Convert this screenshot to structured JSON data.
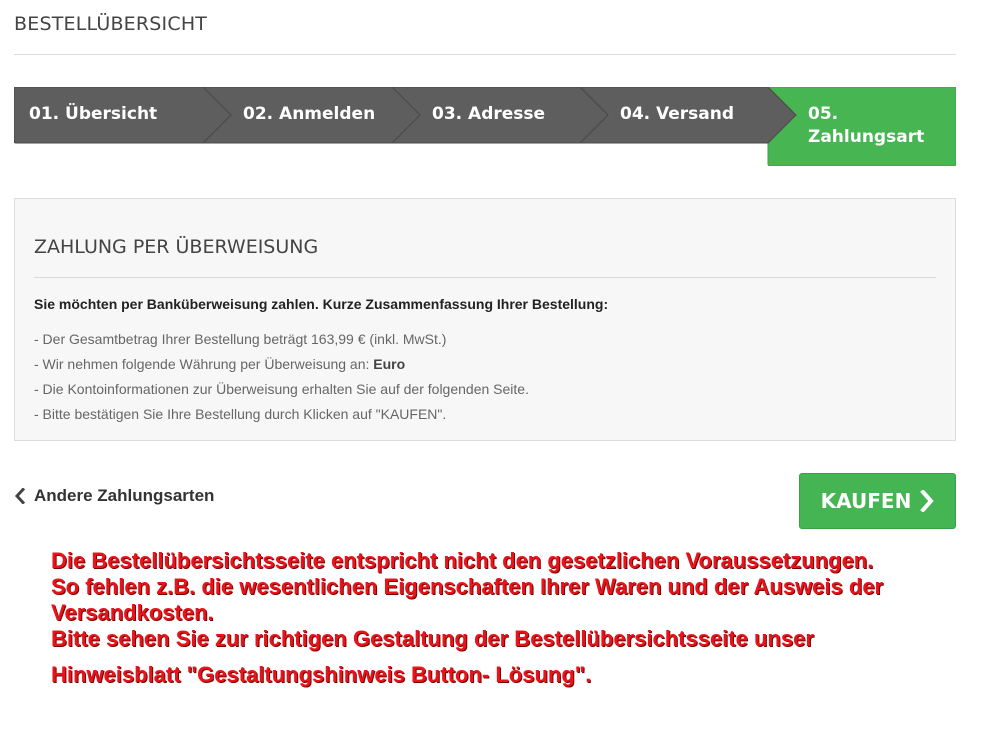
{
  "page": {
    "title": "BESTELLÜBERSICHT"
  },
  "steps": [
    {
      "label": "01. Übersicht",
      "active": false
    },
    {
      "label": "02. Anmelden",
      "active": false
    },
    {
      "label": "03. Adresse",
      "active": false
    },
    {
      "label": "04. Versand",
      "active": false
    },
    {
      "label_line1": "05.",
      "label_line2": "Zahlungsart",
      "active": true
    }
  ],
  "colors": {
    "step_inactive": "#5e5e5e",
    "step_active": "#47b552",
    "accent_red": "#e8141b"
  },
  "panel": {
    "title": "ZAHLUNG PER ÜBERWEISUNG",
    "intro": "Sie möchten per Banküberweisung zahlen. Kurze Zusammenfassung Ihrer Bestellung:",
    "items": [
      "- Der Gesamtbetrag Ihrer Bestellung beträgt 163,99 € (inkl. MwSt.)",
      {
        "prefix": "- Wir nehmen folgende Währung per Überweisung an: ",
        "bold": "Euro"
      },
      "- Die Kontoinformationen zur Überweisung erhalten Sie auf der folgenden Seite.",
      "- Bitte bestätigen Sie Ihre Bestellung durch Klicken auf \"KAUFEN\"."
    ]
  },
  "actions": {
    "back_label": "Andere Zahlungsarten",
    "back_icon": "chevron-left-icon",
    "buy_label": "KAUFEN",
    "buy_icon": "chevron-right-icon"
  },
  "annotation": {
    "lines": [
      "Die Bestellübersichtsseite entspricht nicht den gesetzlichen Voraussetzungen.",
      "So fehlen z.B. die wesentlichen Eigenschaften Ihrer Waren und der Ausweis der",
      "Versandkosten.",
      "Bitte sehen Sie zur richtigen Gestaltung der Bestellübersichtsseite unser",
      "Hinweisblatt \"Gestaltungshinweis Button- Lösung\"."
    ]
  }
}
